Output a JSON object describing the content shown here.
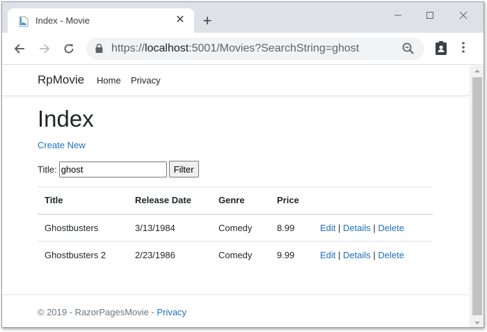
{
  "browser": {
    "tab_title": "Index - Movie",
    "tab_close": "✕",
    "new_tab": "+",
    "url_scheme": "https://",
    "url_host": "localhost",
    "url_rest": ":5001/Movies?SearchString=ghost",
    "icons": {
      "back": "arrow-left-icon",
      "forward": "arrow-right-icon",
      "reload": "reload-icon",
      "lock": "lock-icon",
      "zoom": "zoom-out-icon",
      "extension": "clipboard-person-icon",
      "menu": "kebab-menu-icon",
      "minimize": "minimize-icon",
      "maximize": "maximize-icon",
      "close": "close-icon"
    }
  },
  "site": {
    "brand": "RpMovie",
    "nav": [
      {
        "label": "Home"
      },
      {
        "label": "Privacy"
      }
    ]
  },
  "main": {
    "title": "Index",
    "create_link": "Create New",
    "filter": {
      "label": "Title:",
      "value": "ghost",
      "button": "Filter"
    },
    "table": {
      "headers": [
        "Title",
        "Release Date",
        "Genre",
        "Price"
      ],
      "rows": [
        {
          "title": "Ghostbusters",
          "release_date": "3/13/1984",
          "genre": "Comedy",
          "price": "8.99",
          "edit": "Edit",
          "details": "Details",
          "delete": "Delete"
        },
        {
          "title": "Ghostbusters 2",
          "release_date": "2/23/1986",
          "genre": "Comedy",
          "price": "9.99",
          "edit": "Edit",
          "details": "Details",
          "delete": "Delete"
        }
      ],
      "separator": "|"
    }
  },
  "footer": {
    "text": "© 2019 - RazorPagesMovie - ",
    "link": "Privacy"
  },
  "colors": {
    "link": "#1b6ec2",
    "tabstrip": "#dee1e6",
    "omnibox": "#f1f3f4"
  }
}
